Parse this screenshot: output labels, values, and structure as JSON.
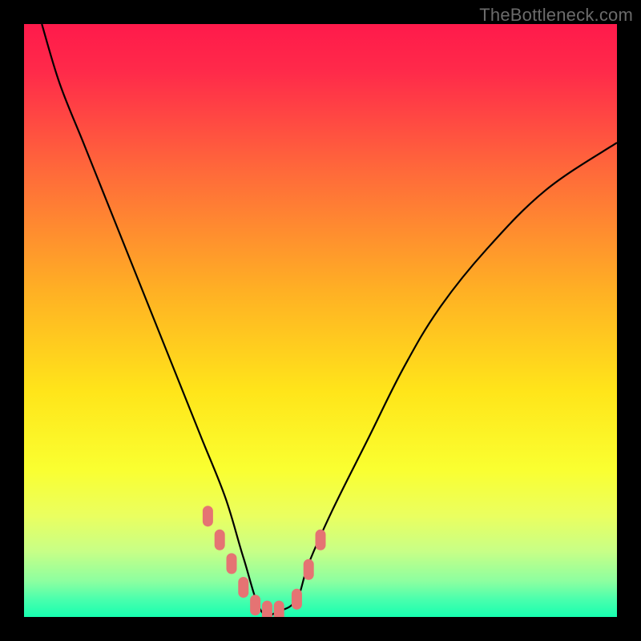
{
  "watermark": "TheBottleneck.com",
  "colors": {
    "frame": "#000000",
    "curve": "#000000",
    "marker": "#e57373",
    "gradient_stops": [
      {
        "pct": 0,
        "color": "#ff1a4b"
      },
      {
        "pct": 8,
        "color": "#ff2a4a"
      },
      {
        "pct": 25,
        "color": "#ff6a3a"
      },
      {
        "pct": 45,
        "color": "#ffb024"
      },
      {
        "pct": 62,
        "color": "#ffe51a"
      },
      {
        "pct": 75,
        "color": "#faff30"
      },
      {
        "pct": 83,
        "color": "#eaff60"
      },
      {
        "pct": 89,
        "color": "#c7ff87"
      },
      {
        "pct": 94,
        "color": "#8cffa0"
      },
      {
        "pct": 97,
        "color": "#4affad"
      },
      {
        "pct": 100,
        "color": "#17ffb0"
      }
    ]
  },
  "chart_data": {
    "type": "line",
    "title": "",
    "xlabel": "",
    "ylabel": "",
    "xlim": [
      0,
      100
    ],
    "ylim": [
      0,
      100
    ],
    "note": "y measured as percent upward from the green baseline (bottom = 0, top = 100); x is percent across the plot area. Curve is a V-shaped bottleneck curve with minimum near x≈40.",
    "series": [
      {
        "name": "bottleneck-curve",
        "x": [
          3,
          6,
          10,
          14,
          18,
          22,
          26,
          30,
          34,
          37,
          40,
          43,
          46,
          48,
          52,
          58,
          64,
          70,
          78,
          88,
          100
        ],
        "values": [
          100,
          90,
          80,
          70,
          60,
          50,
          40,
          30,
          20,
          10,
          1,
          1,
          3,
          9,
          18,
          30,
          42,
          52,
          62,
          72,
          80
        ]
      }
    ],
    "markers": {
      "name": "highlighted-range",
      "x": [
        31,
        33,
        35,
        37,
        39,
        41,
        43,
        46,
        48,
        50
      ],
      "values": [
        17,
        13,
        9,
        5,
        2,
        1,
        1,
        3,
        8,
        13
      ]
    }
  }
}
